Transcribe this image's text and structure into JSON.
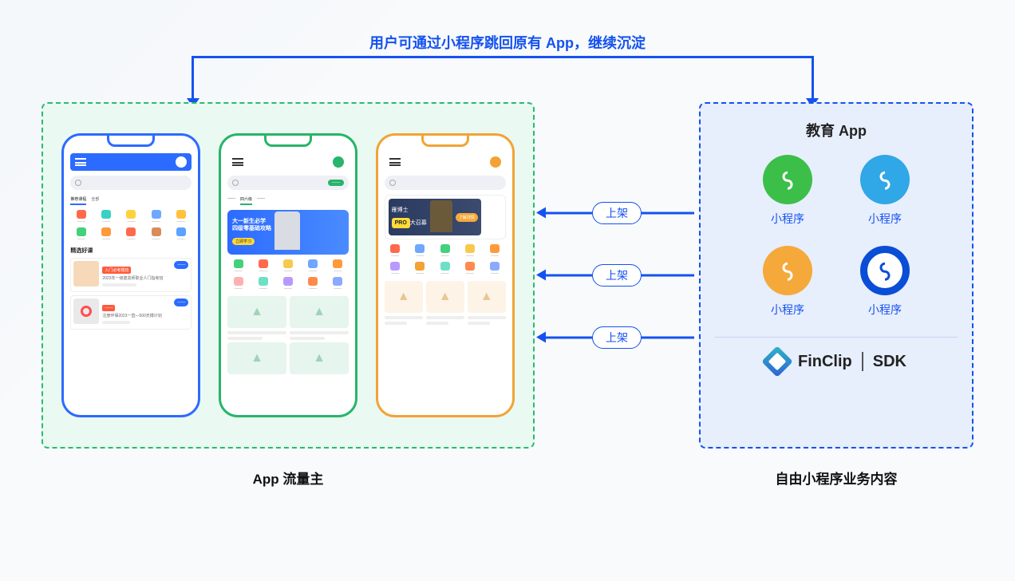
{
  "top_text": "用户可通过小程序跳回原有 App，继续沉淀",
  "flow_labels": [
    "上架",
    "上架",
    "上架"
  ],
  "left_caption": "App 流量主",
  "right_caption": "自由小程序业务内容",
  "right_panel": {
    "title": "教育 App",
    "items": [
      "小程序",
      "小程序",
      "小程序",
      "小程序"
    ],
    "brand": "FinClip",
    "sdk": "SDK"
  },
  "phone1": {
    "tab1": "推荐课程",
    "tab2": "全部",
    "section": "精选好课",
    "tag1": "入门必考题班",
    "card1": "2023年一级建造师职业人门指考班",
    "card2": "注册环保2023一直—500天搏计划"
  },
  "phone2": {
    "tab_active": "四六级",
    "banner_line1": "大一新生必学",
    "banner_line2": "四级零基础攻略"
  },
  "phone3": {
    "pro": "PRO",
    "title_prefix": "雁博士",
    "title_suffix": "大召募"
  }
}
